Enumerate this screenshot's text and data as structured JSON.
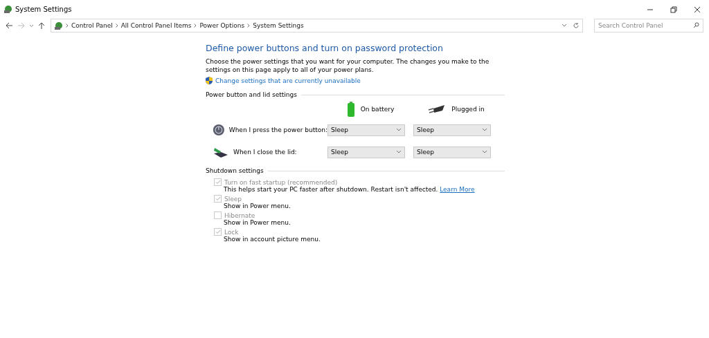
{
  "window": {
    "title": "System Settings"
  },
  "breadcrumb": [
    "Control Panel",
    "All Control Panel Items",
    "Power Options",
    "System Settings"
  ],
  "search": {
    "placeholder": "Search Control Panel"
  },
  "heading": "Define power buttons and turn on password protection",
  "intro": "Choose the power settings that you want for your computer. The changes you make to the settings on this page apply to all of your power plans.",
  "admin_link": "Change settings that are currently unavailable",
  "power_section": {
    "title": "Power button and lid settings",
    "columns": [
      {
        "label": "On battery",
        "kind": "battery"
      },
      {
        "label": "Plugged in",
        "kind": "plug"
      }
    ],
    "rows": [
      {
        "label": "When I press the power button:",
        "kind": "power",
        "values": [
          "Sleep",
          "Sleep"
        ]
      },
      {
        "label": "When I close the lid:",
        "kind": "lid",
        "values": [
          "Sleep",
          "Sleep"
        ]
      }
    ]
  },
  "shutdown_section": {
    "title": "Shutdown settings",
    "options": [
      {
        "label": "Turn on fast startup (recommended)",
        "checked": true,
        "disabled": true,
        "description": "This helps start your PC faster after shutdown. Restart isn't affected.",
        "link": "Learn More"
      },
      {
        "label": "Sleep",
        "checked": true,
        "disabled": true,
        "description": "Show in Power menu."
      },
      {
        "label": "Hibernate",
        "checked": false,
        "disabled": true,
        "description": "Show in Power menu."
      },
      {
        "label": "Lock",
        "checked": true,
        "disabled": true,
        "description": "Show in account picture menu."
      }
    ]
  }
}
